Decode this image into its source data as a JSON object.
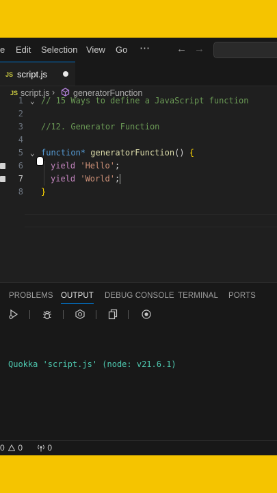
{
  "menu": {
    "items": [
      {
        "label": "e"
      },
      {
        "label": "Edit"
      },
      {
        "label": "Selection"
      },
      {
        "label": "View"
      },
      {
        "label": "Go"
      },
      {
        "label": "⋯"
      }
    ],
    "back_icon": "←",
    "forward_icon": "→"
  },
  "tab": {
    "badge": "JS",
    "label": "script.js"
  },
  "breadcrumb": {
    "badge": "JS",
    "file": "script.js",
    "separator": "›",
    "symbol": "generatorFunction"
  },
  "editor": {
    "lines": [
      {
        "num": "1",
        "comment": "// 15 Ways to define a JavaScript function"
      },
      {
        "num": "2"
      },
      {
        "num": "3",
        "comment": "//12. Generator Function"
      },
      {
        "num": "4"
      },
      {
        "num": "5",
        "kw": "function*",
        "fn": "generatorFunction",
        "paren": "()",
        "brace": "{"
      },
      {
        "num": "6",
        "kw": "yield",
        "str": "'Hello'",
        "semi": ";"
      },
      {
        "num": "7",
        "kw": "yield",
        "str": "'World'",
        "semi": ";"
      },
      {
        "num": "8",
        "brace": "}"
      }
    ]
  },
  "panel": {
    "tabs": [
      "PROBLEMS",
      "OUTPUT",
      "DEBUG CONSOLE",
      "TERMINAL",
      "PORTS"
    ],
    "output": "Quokka 'script.js' (node: v21.6.1)"
  },
  "status": {
    "errors": "0",
    "warnings": "0",
    "ports": "0"
  },
  "colors": {
    "accent": "#0078d4",
    "background": "#f5c400",
    "editor_bg": "#1f1f1f"
  }
}
